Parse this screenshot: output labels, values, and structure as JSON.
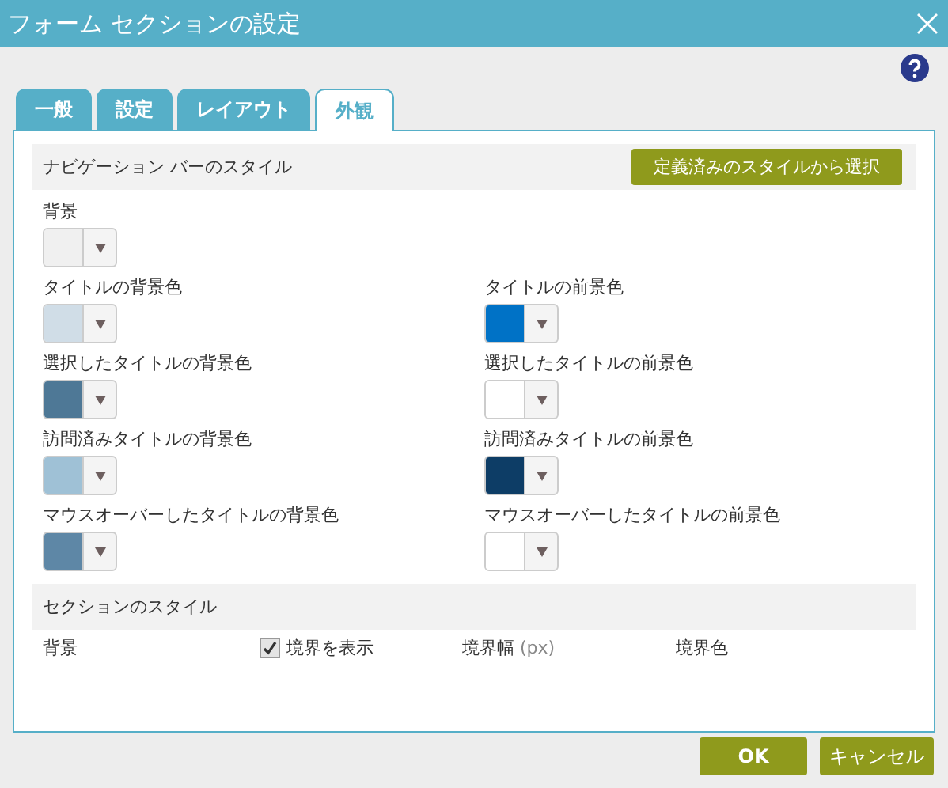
{
  "window": {
    "title": "フォーム セクションの設定"
  },
  "tabs": [
    {
      "label": "一般",
      "selected": false
    },
    {
      "label": "設定",
      "selected": false
    },
    {
      "label": "レイアウト",
      "selected": false
    },
    {
      "label": "外観",
      "selected": true
    }
  ],
  "navigation_bar_style": {
    "heading": "ナビゲーション バーのスタイル",
    "preset_button": "定義済みのスタイルから選択",
    "rows": [
      [
        {
          "label": "背景",
          "color": "#f0f0f0"
        }
      ],
      [
        {
          "label": "タイトルの背景色",
          "color": "#d0dde7"
        },
        {
          "label": "タイトルの前景色",
          "color": "#0072c6"
        }
      ],
      [
        {
          "label": "選択したタイトルの背景色",
          "color": "#4e7896"
        },
        {
          "label": "選択したタイトルの前景色",
          "color": "#ffffff"
        }
      ],
      [
        {
          "label": "訪問済みタイトルの背景色",
          "color": "#9fc1d6"
        },
        {
          "label": "訪問済みタイトルの前景色",
          "color": "#0d3d66"
        }
      ],
      [
        {
          "label": "マウスオーバーしたタイトルの背景色",
          "color": "#5e87a6"
        },
        {
          "label": "マウスオーバーしたタイトルの前景色",
          "color": "#ffffff"
        }
      ]
    ]
  },
  "section_style": {
    "heading": "セクションのスタイル",
    "fields": [
      {
        "kind": "label",
        "label": "背景"
      },
      {
        "kind": "checkbox",
        "label": "境界を表示",
        "checked": true
      },
      {
        "kind": "label",
        "label": "境界幅",
        "unit": "(px)"
      },
      {
        "kind": "label",
        "label": "境界色"
      }
    ]
  },
  "buttons": [
    {
      "label": "OK"
    },
    {
      "label": "キャンセル"
    }
  ]
}
